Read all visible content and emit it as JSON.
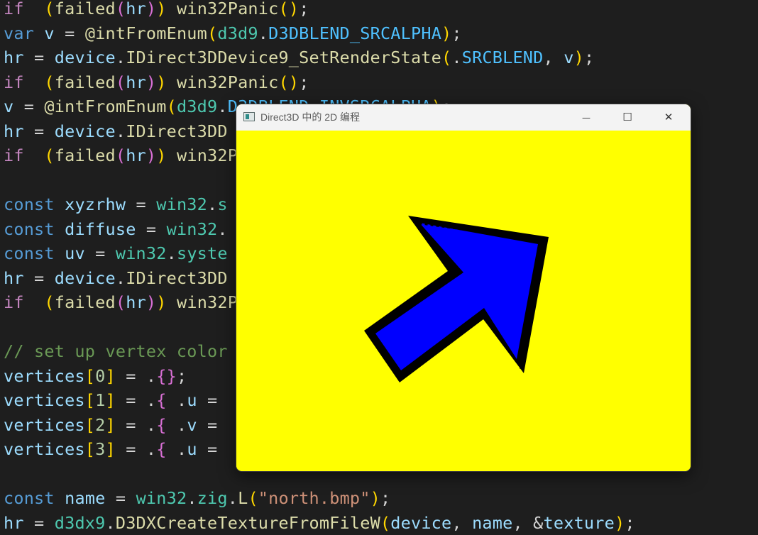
{
  "code_lines": [
    [
      [
        "kw",
        "if"
      ],
      [
        "",
        "  "
      ],
      [
        "br1",
        "("
      ],
      [
        "fn",
        "failed"
      ],
      [
        "br2",
        "("
      ],
      [
        "vr",
        "hr"
      ],
      [
        "br2",
        ")"
      ],
      [
        "br1",
        ")"
      ],
      [
        "",
        " "
      ],
      [
        "fn",
        "win32Panic"
      ],
      [
        "br1",
        "("
      ],
      [
        "br1",
        ")"
      ],
      [
        "",
        ";"
      ]
    ],
    [
      [
        "kw2",
        "var"
      ],
      [
        "",
        " "
      ],
      [
        "vr",
        "v"
      ],
      [
        "",
        " = "
      ],
      [
        "fn",
        "@intFromEnum"
      ],
      [
        "br1",
        "("
      ],
      [
        "ty",
        "d3d9"
      ],
      [
        "",
        "."
      ],
      [
        "en",
        "D3DBLEND_SRCALPHA"
      ],
      [
        "br1",
        ")"
      ],
      [
        "",
        ";"
      ]
    ],
    [
      [
        "vr",
        "hr"
      ],
      [
        "",
        " = "
      ],
      [
        "vr",
        "device"
      ],
      [
        "",
        "."
      ],
      [
        "fn",
        "IDirect3DDevice9_SetRenderState"
      ],
      [
        "br1",
        "("
      ],
      [
        "",
        "."
      ],
      [
        "en",
        "SRCBLEND"
      ],
      [
        "",
        ", "
      ],
      [
        "vr",
        "v"
      ],
      [
        "br1",
        ")"
      ],
      [
        "",
        ";"
      ]
    ],
    [
      [
        "kw",
        "if"
      ],
      [
        "",
        "  "
      ],
      [
        "br1",
        "("
      ],
      [
        "fn",
        "failed"
      ],
      [
        "br2",
        "("
      ],
      [
        "vr",
        "hr"
      ],
      [
        "br2",
        ")"
      ],
      [
        "br1",
        ")"
      ],
      [
        "",
        " "
      ],
      [
        "fn",
        "win32Panic"
      ],
      [
        "br1",
        "("
      ],
      [
        "br1",
        ")"
      ],
      [
        "",
        ";"
      ]
    ],
    [
      [
        "vr",
        "v"
      ],
      [
        "",
        " = "
      ],
      [
        "fn",
        "@intFromEnum"
      ],
      [
        "br1",
        "("
      ],
      [
        "ty",
        "d3d9"
      ],
      [
        "",
        "."
      ],
      [
        "en",
        "D3DBLEND_INVSRCALPHA"
      ],
      [
        "br1",
        ")"
      ],
      [
        "",
        ";"
      ]
    ],
    [
      [
        "vr",
        "hr"
      ],
      [
        "",
        " = "
      ],
      [
        "vr",
        "device"
      ],
      [
        "",
        "."
      ],
      [
        "fn",
        "IDirect3DD"
      ]
    ],
    [
      [
        "kw",
        "if"
      ],
      [
        "",
        "  "
      ],
      [
        "br1",
        "("
      ],
      [
        "fn",
        "failed"
      ],
      [
        "br2",
        "("
      ],
      [
        "vr",
        "hr"
      ],
      [
        "br2",
        ")"
      ],
      [
        "br1",
        ")"
      ],
      [
        "",
        " "
      ],
      [
        "fn",
        "win32P"
      ]
    ],
    [],
    [
      [
        "kw2",
        "const"
      ],
      [
        "",
        " "
      ],
      [
        "vr",
        "xyzrhw"
      ],
      [
        "",
        " = "
      ],
      [
        "ty",
        "win32"
      ],
      [
        "",
        "."
      ],
      [
        "ty",
        "s"
      ]
    ],
    [
      [
        "kw2",
        "const"
      ],
      [
        "",
        " "
      ],
      [
        "vr",
        "diffuse"
      ],
      [
        "",
        " = "
      ],
      [
        "ty",
        "win32"
      ],
      [
        "",
        "."
      ]
    ],
    [
      [
        "kw2",
        "const"
      ],
      [
        "",
        " "
      ],
      [
        "vr",
        "uv"
      ],
      [
        "",
        " = "
      ],
      [
        "ty",
        "win32"
      ],
      [
        "",
        "."
      ],
      [
        "ty",
        "syste"
      ]
    ],
    [
      [
        "vr",
        "hr"
      ],
      [
        "",
        " = "
      ],
      [
        "vr",
        "device"
      ],
      [
        "",
        "."
      ],
      [
        "fn",
        "IDirect3DD"
      ]
    ],
    [
      [
        "kw",
        "if"
      ],
      [
        "",
        "  "
      ],
      [
        "br1",
        "("
      ],
      [
        "fn",
        "failed"
      ],
      [
        "br2",
        "("
      ],
      [
        "vr",
        "hr"
      ],
      [
        "br2",
        ")"
      ],
      [
        "br1",
        ")"
      ],
      [
        "",
        " "
      ],
      [
        "fn",
        "win32P"
      ]
    ],
    [],
    [
      [
        "cm",
        "// set up vertex color"
      ]
    ],
    [
      [
        "vr",
        "vertices"
      ],
      [
        "br1",
        "["
      ],
      [
        "nm",
        "0"
      ],
      [
        "br1",
        "]"
      ],
      [
        "",
        " = ."
      ],
      [
        "br2",
        "{"
      ],
      [
        "br2",
        "}"
      ],
      [
        "",
        ";"
      ]
    ],
    [
      [
        "vr",
        "vertices"
      ],
      [
        "br1",
        "["
      ],
      [
        "nm",
        "1"
      ],
      [
        "br1",
        "]"
      ],
      [
        "",
        " = ."
      ],
      [
        "br2",
        "{"
      ],
      [
        "",
        " ."
      ],
      [
        "vr",
        "u"
      ],
      [
        "",
        " ="
      ]
    ],
    [
      [
        "vr",
        "vertices"
      ],
      [
        "br1",
        "["
      ],
      [
        "nm",
        "2"
      ],
      [
        "br1",
        "]"
      ],
      [
        "",
        " = ."
      ],
      [
        "br2",
        "{"
      ],
      [
        "",
        " ."
      ],
      [
        "vr",
        "v"
      ],
      [
        "",
        " ="
      ]
    ],
    [
      [
        "vr",
        "vertices"
      ],
      [
        "br1",
        "["
      ],
      [
        "nm",
        "3"
      ],
      [
        "br1",
        "]"
      ],
      [
        "",
        " = ."
      ],
      [
        "br2",
        "{"
      ],
      [
        "",
        " ."
      ],
      [
        "vr",
        "u"
      ],
      [
        "",
        " ="
      ]
    ],
    [],
    [
      [
        "kw2",
        "const"
      ],
      [
        "",
        " "
      ],
      [
        "vr",
        "name"
      ],
      [
        "",
        " = "
      ],
      [
        "ty",
        "win32"
      ],
      [
        "",
        "."
      ],
      [
        "ty",
        "zig"
      ],
      [
        "",
        "."
      ],
      [
        "fn",
        "L"
      ],
      [
        "br1",
        "("
      ],
      [
        "st",
        "\"north.bmp\""
      ],
      [
        "br1",
        ")"
      ],
      [
        "",
        ";"
      ]
    ],
    [
      [
        "vr",
        "hr"
      ],
      [
        "",
        " = "
      ],
      [
        "ty",
        "d3dx9"
      ],
      [
        "",
        "."
      ],
      [
        "fn",
        "D3DXCreateTextureFromFileW"
      ],
      [
        "br1",
        "("
      ],
      [
        "vr",
        "device"
      ],
      [
        "",
        ", "
      ],
      [
        "vr",
        "name"
      ],
      [
        "",
        ", &"
      ],
      [
        "vr",
        "texture"
      ],
      [
        "br1",
        ")"
      ],
      [
        "",
        ";"
      ]
    ]
  ],
  "window": {
    "title": "Direct3D 中的 2D 编程",
    "minimize_glyph": "—",
    "maximize_glyph": "☐",
    "close_glyph": "✕",
    "client_color": "#ffff00",
    "arrow_fill": "#0000ff",
    "arrow_outline": "#000000"
  },
  "colors": {
    "editor_background": "#1e1e1e"
  }
}
